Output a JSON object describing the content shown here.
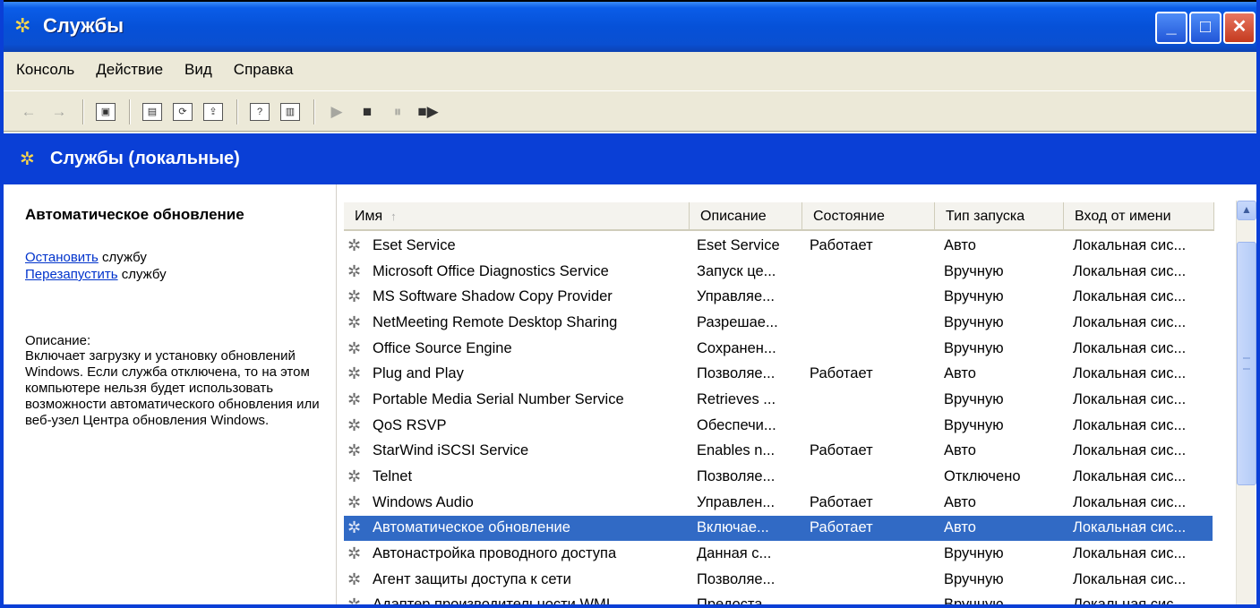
{
  "window": {
    "title": "Службы",
    "app_icon": "services-gears-icon",
    "controls": {
      "minimize": "_",
      "maximize": "□",
      "close": "✕"
    },
    "accent_color": "#0a3fd6"
  },
  "menu": [
    {
      "label": "Консоль"
    },
    {
      "label": "Действие"
    },
    {
      "label": "Вид"
    },
    {
      "label": "Справка"
    }
  ],
  "toolbar": {
    "back": "←",
    "forward": "→",
    "show_hide_tree": "▣",
    "properties": "▤",
    "refresh": "⟳",
    "export": "⇪",
    "help": "?",
    "show_hide_action": "▥",
    "play": "▶",
    "stop": "■",
    "pause": "⏸",
    "restart": "■▶"
  },
  "header": {
    "title": "Службы (локальные)"
  },
  "left_pane": {
    "selected_service": "Автоматическое обновление",
    "stop_link": "Остановить",
    "restart_link": "Перезапустить",
    "action_suffix": " службу",
    "description_label": "Описание:",
    "description": "Включает загрузку и установку обновлений Windows. Если служба отключена, то на этом компьютере нельзя будет использовать возможности автоматического обновления или веб-узел Центра обновления Windows."
  },
  "table": {
    "columns": [
      "Имя",
      "Описание",
      "Состояние",
      "Тип запуска",
      "Вход от имени"
    ],
    "sort_indicator": "↑",
    "rows": [
      {
        "name": "Eset Service",
        "desc": "Eset Service",
        "state": "Работает",
        "startup": "Авто",
        "logon": "Локальная сис..."
      },
      {
        "name": "Microsoft Office Diagnostics Service",
        "desc": "Запуск це...",
        "state": "",
        "startup": "Вручную",
        "logon": "Локальная сис..."
      },
      {
        "name": "MS Software Shadow Copy Provider",
        "desc": "Управляе...",
        "state": "",
        "startup": "Вручную",
        "logon": "Локальная сис..."
      },
      {
        "name": "NetMeeting Remote Desktop Sharing",
        "desc": "Разрешае...",
        "state": "",
        "startup": "Вручную",
        "logon": "Локальная сис..."
      },
      {
        "name": "Office Source Engine",
        "desc": "Сохранен...",
        "state": "",
        "startup": "Вручную",
        "logon": "Локальная сис..."
      },
      {
        "name": "Plug and Play",
        "desc": "Позволяе...",
        "state": "Работает",
        "startup": "Авто",
        "logon": "Локальная сис..."
      },
      {
        "name": "Portable Media Serial Number Service",
        "desc": "Retrieves ...",
        "state": "",
        "startup": "Вручную",
        "logon": "Локальная сис..."
      },
      {
        "name": "QoS RSVP",
        "desc": "Обеспечи...",
        "state": "",
        "startup": "Вручную",
        "logon": "Локальная сис..."
      },
      {
        "name": "StarWind iSCSI Service",
        "desc": "Enables n...",
        "state": "Работает",
        "startup": "Авто",
        "logon": "Локальная сис..."
      },
      {
        "name": "Telnet",
        "desc": "Позволяе...",
        "state": "",
        "startup": "Отключено",
        "logon": "Локальная сис..."
      },
      {
        "name": "Windows Audio",
        "desc": "Управлен...",
        "state": "Работает",
        "startup": "Авто",
        "logon": "Локальная сис..."
      },
      {
        "name": "Автоматическое обновление",
        "desc": "Включае...",
        "state": "Работает",
        "startup": "Авто",
        "logon": "Локальная сис...",
        "selected": true
      },
      {
        "name": "Автонастройка проводного доступа",
        "desc": "Данная с...",
        "state": "",
        "startup": "Вручную",
        "logon": "Локальная сис..."
      },
      {
        "name": "Агент защиты доступа к сети",
        "desc": "Позволяе...",
        "state": "",
        "startup": "Вручную",
        "logon": "Локальная сис..."
      },
      {
        "name": "Адаптер производительности WMI",
        "desc": "Предоста...",
        "state": "",
        "startup": "Вручную",
        "logon": "Локальная сис..."
      }
    ]
  },
  "scrollbar": {
    "position": 0.15
  }
}
